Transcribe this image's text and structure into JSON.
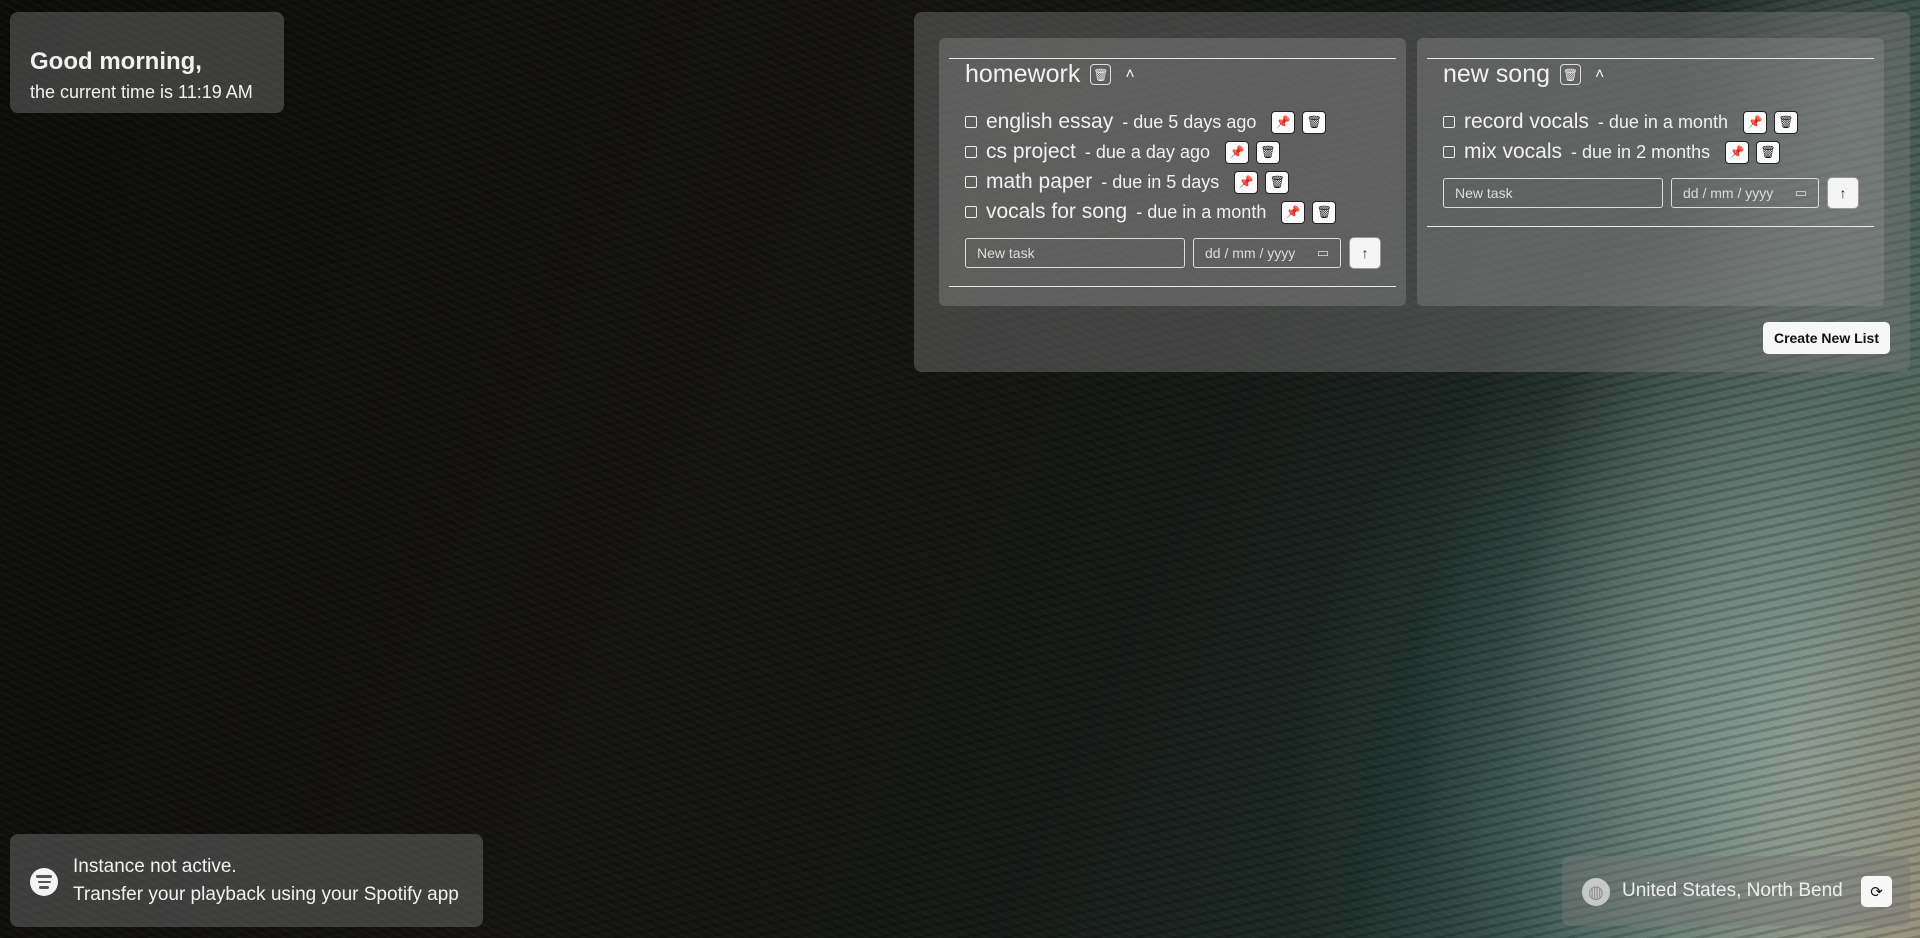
{
  "greeting": {
    "hello": "Good morning,",
    "time_text": "the current time is 11:19 AM"
  },
  "todo": {
    "lists": [
      {
        "title": "homework",
        "tasks": [
          {
            "name": "english essay",
            "due": "- due 5 days ago"
          },
          {
            "name": "cs project",
            "due": "- due a day ago"
          },
          {
            "name": "math paper",
            "due": "- due in 5 days"
          },
          {
            "name": "vocals for song",
            "due": "- due in a month"
          }
        ],
        "new_task_placeholder": "New task",
        "date_placeholder": "dd / mm / yyyy"
      },
      {
        "title": "new song",
        "tasks": [
          {
            "name": "record vocals",
            "due": "- due in a month"
          },
          {
            "name": "mix vocals",
            "due": "- due in 2 months"
          }
        ],
        "new_task_placeholder": "New task",
        "date_placeholder": "dd / mm / yyyy"
      }
    ],
    "create_button": "Create New List"
  },
  "spotify": {
    "line1": "Instance not active.",
    "line2": "Transfer your playback using your Spotify app"
  },
  "location": {
    "place": "United States, North Bend"
  },
  "icons": {
    "trash": "trash-icon",
    "pin": "pin-icon",
    "chevron": "chevron-up-icon",
    "submit": "arrow-up-icon",
    "calendar": "calendar-icon",
    "spotify": "spotify-logo-icon",
    "globe": "globe-icon",
    "refresh": "refresh-icon"
  }
}
